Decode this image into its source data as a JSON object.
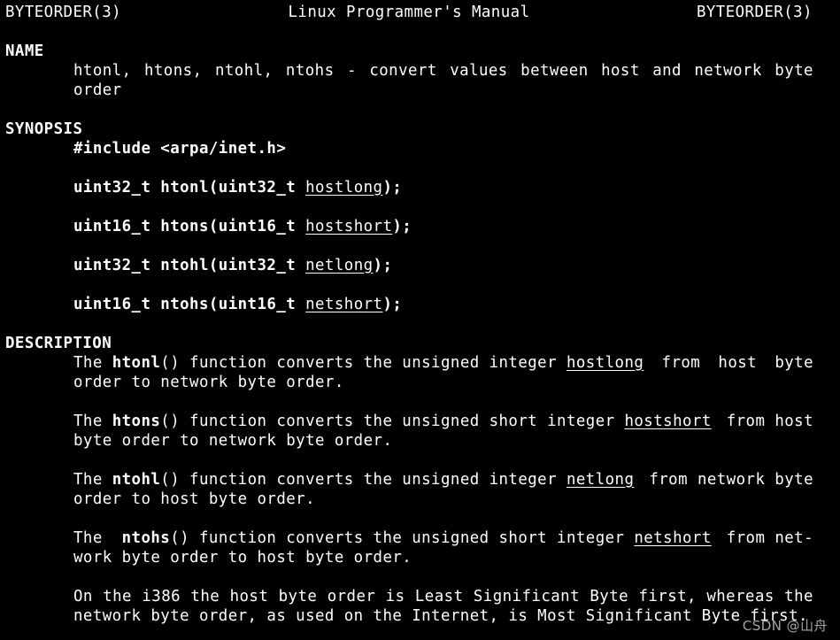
{
  "header": {
    "left": "BYTEORDER(3)",
    "center": "Linux Programmer's Manual",
    "right": "BYTEORDER(3)"
  },
  "name_section": {
    "heading": "NAME",
    "line1_words": [
      "htonl,",
      "htons,",
      "ntohl,",
      "ntohs",
      "-",
      "convert",
      "values",
      "between",
      "host",
      "and",
      "network",
      "byte"
    ],
    "line2": "order"
  },
  "synopsis": {
    "heading": "SYNOPSIS",
    "include_line": "#include <arpa/inet.h>",
    "prototypes": [
      {
        "decl": "uint32_t htonl(uint32_t ",
        "param": "hostlong",
        "end": ");"
      },
      {
        "decl": "uint16_t htons(uint16_t ",
        "param": "hostshort",
        "end": ");"
      },
      {
        "decl": "uint32_t ntohl(uint32_t ",
        "param": "netlong",
        "end": ");"
      },
      {
        "decl": "uint16_t ntohs(uint16_t ",
        "param": "netshort",
        "end": ");"
      }
    ]
  },
  "description": {
    "heading": "DESCRIPTION",
    "p1": {
      "w1": "The",
      "fn": "htonl",
      "mid": "() function converts the unsigned integer",
      "param": "hostlong",
      "w_from": "from",
      "w_host": "host",
      "w_byte": "byte",
      "line2": "order to network byte order."
    },
    "p2": {
      "w1": "The",
      "fn": "htons",
      "mid": "() function converts the unsigned short integer",
      "param": "hostshort",
      "tail": "from host",
      "line2": "byte order to network byte order."
    },
    "p3": {
      "w1": "The",
      "fn": "ntohl",
      "mid": "() function converts the unsigned integer",
      "param": "netlong",
      "tail": "from network byte",
      "line2": "order to host byte order."
    },
    "p4": {
      "w1": "The",
      "fn": "ntohs",
      "mid": "() function converts the unsigned short integer",
      "param": "netshort",
      "tail": "from net-",
      "line2": "work byte order to host byte order."
    },
    "p5": {
      "line1_words": [
        "On",
        "the",
        "i386",
        "the",
        "host",
        "byte",
        "order",
        "is",
        "Least",
        "Significant",
        "Byte",
        "first,",
        "whereas",
        "the"
      ],
      "line2": "network byte order, as used on the Internet, is Most Significant Byte first."
    }
  },
  "watermark": "CSDN @山舟"
}
